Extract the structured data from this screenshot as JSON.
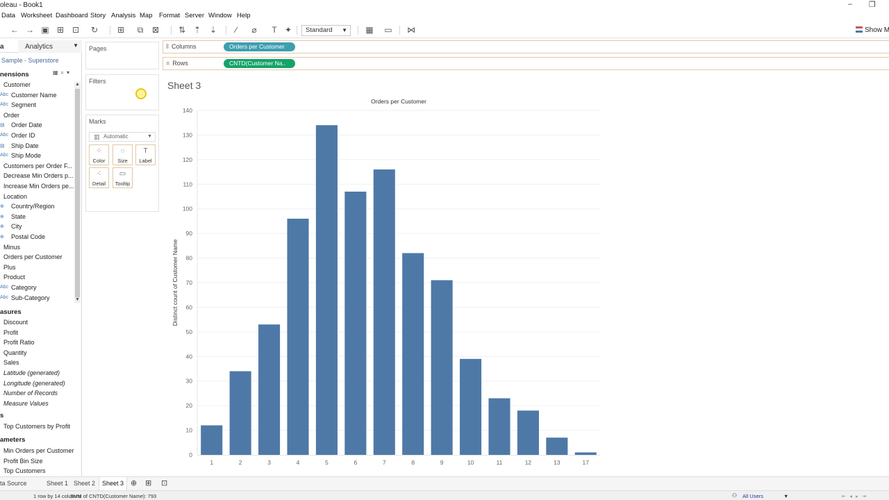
{
  "window": {
    "title": "oleau - Book1",
    "minimize": "–",
    "restore": "❐"
  },
  "menu": [
    "Data",
    "Worksheet",
    "Dashboard",
    "Story",
    "Analysis",
    "Map",
    "Format",
    "Server",
    "Window",
    "Help"
  ],
  "toolbar": {
    "fit_select": "Standard",
    "show_me": "Show M"
  },
  "datapane": {
    "tab_data": "a",
    "tab_analytics": "Analytics",
    "source": "Sample - Superstore",
    "dimensions_header": "nensions",
    "dimensions": [
      {
        "label": "Customer",
        "icon": "",
        "indent": false
      },
      {
        "label": "Customer Name",
        "icon": "Abc",
        "indent": true
      },
      {
        "label": "Segment",
        "icon": "Abc",
        "indent": true
      },
      {
        "label": "Order",
        "icon": "",
        "indent": false
      },
      {
        "label": "Order Date",
        "icon": "▤",
        "indent": true
      },
      {
        "label": "Order ID",
        "icon": "Abc",
        "indent": true
      },
      {
        "label": "Ship Date",
        "icon": "▤",
        "indent": true
      },
      {
        "label": "Ship Mode",
        "icon": "Abc",
        "indent": true
      },
      {
        "label": "Customers per Order F...",
        "icon": "",
        "indent": false
      },
      {
        "label": "Decrease Min Orders p...",
        "icon": "",
        "indent": false
      },
      {
        "label": "Increase Min Orders pe...",
        "icon": "",
        "indent": false
      },
      {
        "label": "Location",
        "icon": "",
        "indent": false
      },
      {
        "label": "Country/Region",
        "icon": "⊕",
        "indent": true
      },
      {
        "label": "State",
        "icon": "⊕",
        "indent": true
      },
      {
        "label": "City",
        "icon": "⊕",
        "indent": true
      },
      {
        "label": "Postal Code",
        "icon": "⊕",
        "indent": true
      },
      {
        "label": "Minus",
        "icon": "",
        "indent": false
      },
      {
        "label": "Orders per Customer",
        "icon": "",
        "indent": false
      },
      {
        "label": "Plus",
        "icon": "",
        "indent": false
      },
      {
        "label": "Product",
        "icon": "",
        "indent": false
      },
      {
        "label": "Category",
        "icon": "Abc",
        "indent": true
      },
      {
        "label": "Sub-Category",
        "icon": "Abc",
        "indent": true
      }
    ],
    "measures_header": "asures",
    "measures": [
      {
        "label": "Discount",
        "italic": false
      },
      {
        "label": "Profit",
        "italic": false
      },
      {
        "label": "Profit Ratio",
        "italic": false
      },
      {
        "label": "Quantity",
        "italic": false
      },
      {
        "label": "Sales",
        "italic": false
      },
      {
        "label": "Latitude (generated)",
        "italic": true
      },
      {
        "label": "Longitude (generated)",
        "italic": true
      },
      {
        "label": "Number of Records",
        "italic": true
      },
      {
        "label": "Measure Values",
        "italic": true
      }
    ],
    "sets_header": "s",
    "sets": [
      "Top Customers by Profit"
    ],
    "parameters_header": "ameters",
    "parameters": [
      "Min Orders per Customer",
      "Profit Bin Size",
      "Top Customers"
    ]
  },
  "cards": {
    "pages": "Pages",
    "filters": "Filters",
    "marks": "Marks",
    "marks_type": "Automatic",
    "mark_buttons": [
      {
        "label": "Color",
        "icon": "color-icon",
        "glyph": "⁘"
      },
      {
        "label": "Size",
        "icon": "size-icon",
        "glyph": "◌"
      },
      {
        "label": "Label",
        "icon": "label-icon",
        "glyph": "T"
      },
      {
        "label": "Detail",
        "icon": "detail-icon",
        "glyph": "⁖"
      },
      {
        "label": "Tooltip",
        "icon": "tooltip-icon",
        "glyph": "▭"
      }
    ]
  },
  "shelves": {
    "columns_label": "Columns",
    "columns_pill": "Orders per Customer",
    "rows_label": "Rows",
    "rows_pill": "CNTD(Customer Na..",
    "columns_color": "#3d9fb0",
    "rows_color": "#16a36a"
  },
  "sheet_title": "Sheet 3",
  "chart_data": {
    "type": "bar",
    "title": "Orders per Customer",
    "xlabel": "",
    "ylabel": "Distinct count of Customer Name",
    "categories": [
      "1",
      "2",
      "3",
      "4",
      "5",
      "6",
      "7",
      "8",
      "9",
      "10",
      "11",
      "12",
      "13",
      "17"
    ],
    "values": [
      12,
      34,
      53,
      96,
      134,
      107,
      116,
      82,
      71,
      39,
      23,
      18,
      7,
      1
    ],
    "ylim": [
      0,
      140
    ],
    "yticks": [
      0,
      10,
      20,
      30,
      40,
      50,
      60,
      70,
      80,
      90,
      100,
      110,
      120,
      130,
      140
    ],
    "bar_color": "#4e79a7",
    "grid": true
  },
  "bottom_tabs": {
    "data_source": "ta Source",
    "sheets": [
      "Sheet 1",
      "Sheet 2",
      "Sheet 3"
    ],
    "active": "Sheet 3"
  },
  "status": {
    "summary": "1 row by 14 columns",
    "sum": "SUM of CNTD(Customer Name): 793",
    "users": "All Users"
  }
}
